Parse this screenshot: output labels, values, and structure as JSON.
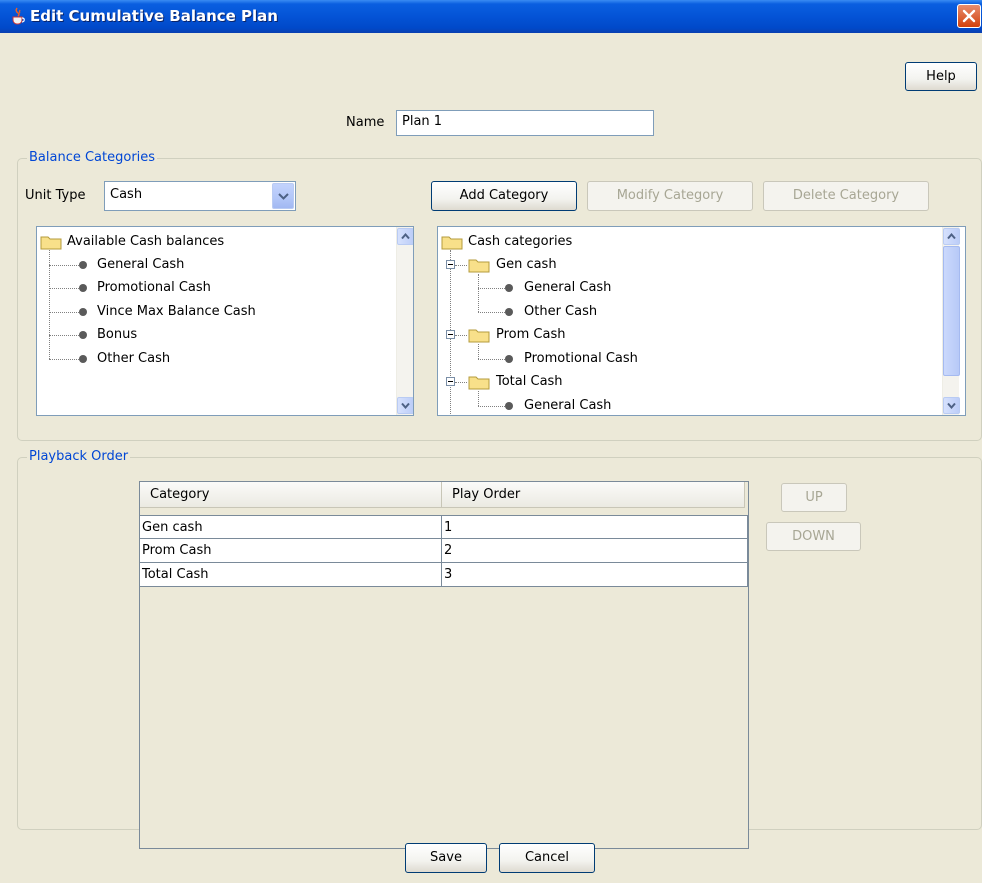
{
  "window": {
    "title": "Edit Cumulative Balance Plan"
  },
  "toolbar": {
    "help_label": "Help"
  },
  "name_field": {
    "label": "Name",
    "value": "Plan 1"
  },
  "balance_categories": {
    "group_title": "Balance Categories",
    "unit_type_label": "Unit Type",
    "unit_type_value": "Cash",
    "add_label": "Add Category",
    "modify_label": "Modify Category",
    "delete_label": "Delete Category",
    "available_tree": {
      "root": "Available Cash balances",
      "items": [
        "General Cash",
        "Promotional Cash",
        "Vince Max Balance Cash",
        "Bonus",
        "Other Cash"
      ]
    },
    "category_tree": {
      "root": "Cash categories",
      "folders": [
        {
          "name": "Gen cash",
          "items": [
            "General Cash",
            "Other Cash"
          ]
        },
        {
          "name": "Prom Cash",
          "items": [
            "Promotional Cash"
          ]
        },
        {
          "name": "Total Cash",
          "items": [
            "General Cash"
          ]
        }
      ]
    }
  },
  "playback": {
    "group_title": "Playback Order",
    "columns": [
      "Category",
      "Play Order"
    ],
    "rows": [
      [
        "Gen cash",
        "1"
      ],
      [
        "Prom Cash",
        "2"
      ],
      [
        "Total Cash",
        "3"
      ]
    ],
    "up_label": "UP",
    "down_label": "DOWN"
  },
  "footer": {
    "save_label": "Save",
    "cancel_label": "Cancel"
  }
}
